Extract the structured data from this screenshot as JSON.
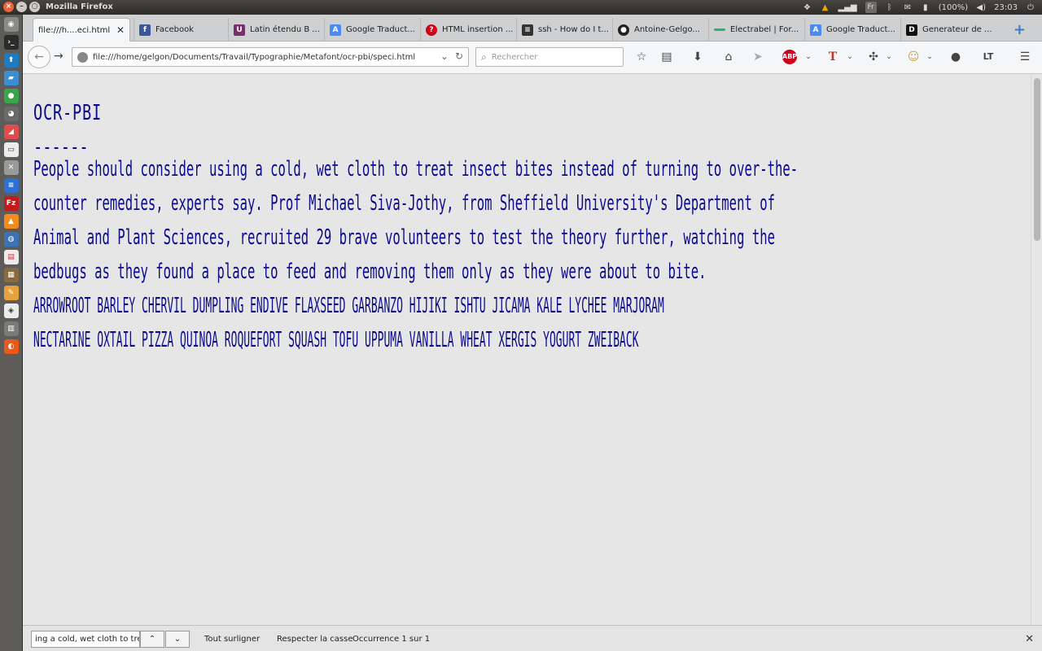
{
  "panel": {
    "window_title": "Mozilla Firefox",
    "lang": "Fr",
    "battery": "(100%)",
    "clock": "23:03"
  },
  "tabs": [
    {
      "label": "file:///h....eci.html",
      "icon": "file-icon",
      "color": "#ffffff"
    },
    {
      "label": "Facebook",
      "icon": "facebook-icon",
      "color": "#3b5998"
    },
    {
      "label": "Latin étendu B ...",
      "icon": "unicode-icon",
      "color": "#7b2f6a"
    },
    {
      "label": "Google Traduct...",
      "icon": "google-translate-icon",
      "color": "#4a8af4"
    },
    {
      "label": "HTML insertion ...",
      "icon": "question-icon",
      "color": "#d0021b"
    },
    {
      "label": "ssh - How do I t...",
      "icon": "stackexchange-icon",
      "color": "#333333"
    },
    {
      "label": "Antoine-Gelgo...",
      "icon": "github-icon",
      "color": "#222222"
    },
    {
      "label": "Electrabel | For...",
      "icon": "electrabel-icon",
      "color": "#29b36e"
    },
    {
      "label": "Google Traduct...",
      "icon": "google-translate-icon",
      "color": "#4a8af4"
    },
    {
      "label": "Generateur de ...",
      "icon": "dj-icon",
      "color": "#111111"
    }
  ],
  "nav": {
    "url": "file:///home/gelgon/Documents/Travail/Typographie/Metafont/ocr-pbi/speci.html",
    "search_placeholder": "Rechercher"
  },
  "page": {
    "title": "OCR-PBI",
    "rule": "------",
    "paragraph1": "People should consider using a cold, wet cloth to treat insect bites instead of turning to over-the-\ncounter remedies, experts say. Prof Michael Siva-Jothy, from Sheffield University's Department of\nAnimal and Plant Sciences, recruited 29 brave volunteers to test the theory further, watching the\nbedbugs as they found a place to feed and removing them only as they were about to bite.",
    "paragraph2": "ARROWROOT BARLEY CHERVIL DUMPLING ENDIVE FLAXSEED GARBANZO HIJIKI ISHTU JICAMA KALE LYCHEE MARJORAM\nNECTARINE OXTAIL PIZZA QUINOA ROQUEFORT SQUASH TOFU UPPUMA VANILLA WHEAT XERGIS YOGURT ZWEIBACK"
  },
  "findbar": {
    "query": "ing a cold, wet cloth to treat",
    "highlight_all": "Tout surligner",
    "match_case": "Respecter la casse",
    "result": "Occurrence 1 sur 1"
  }
}
